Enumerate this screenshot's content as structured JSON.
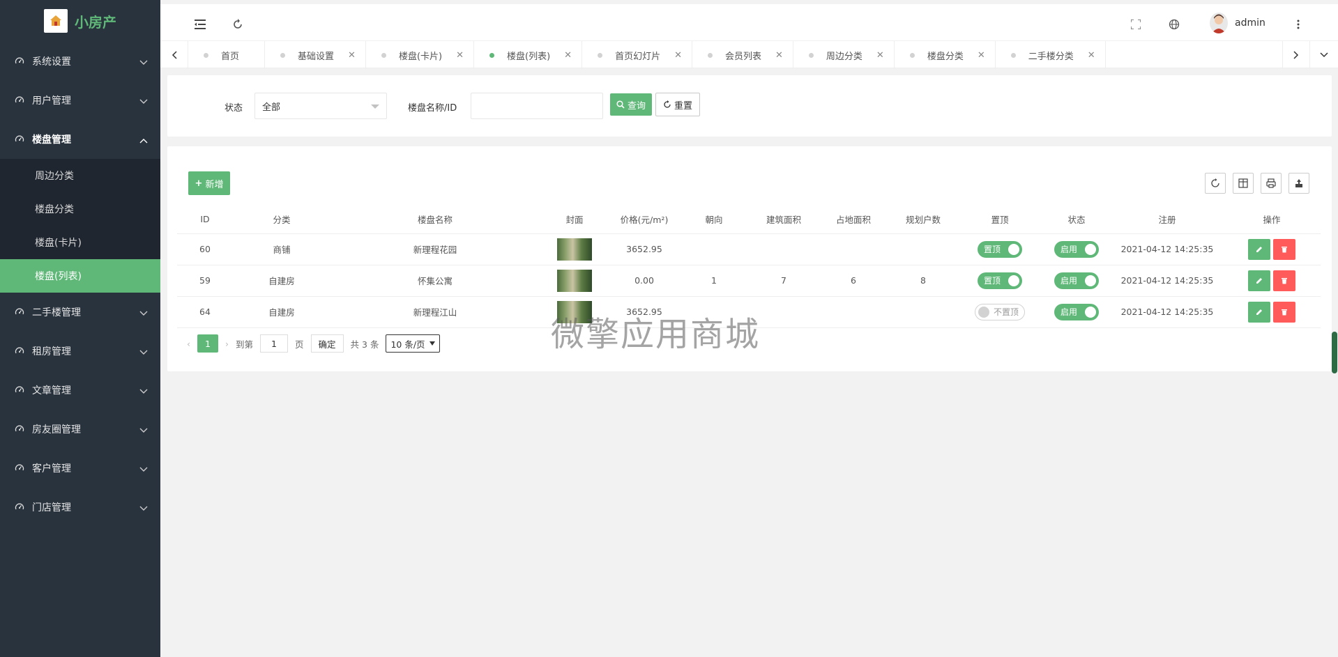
{
  "app": {
    "title": "小房产",
    "logo_icon": "house-logo-icon"
  },
  "colors": {
    "accent": "#5fb878",
    "sidebar_bg": "#28333e",
    "danger": "#ff5b5b"
  },
  "sidebar": {
    "items": [
      {
        "label": "系统设置",
        "open": false
      },
      {
        "label": "用户管理",
        "open": false
      },
      {
        "label": "楼盘管理",
        "open": true
      },
      {
        "label": "二手楼管理",
        "open": false
      },
      {
        "label": "租房管理",
        "open": false
      },
      {
        "label": "文章管理",
        "open": false
      },
      {
        "label": "房友圈管理",
        "open": false
      },
      {
        "label": "客户管理",
        "open": false
      },
      {
        "label": "门店管理",
        "open": false
      }
    ],
    "submenu": [
      {
        "label": "周边分类"
      },
      {
        "label": "楼盘分类"
      },
      {
        "label": "楼盘(卡片)"
      },
      {
        "label": "楼盘(列表)",
        "active": true
      }
    ]
  },
  "header": {
    "user": "admin"
  },
  "tabs": [
    {
      "label": "首页",
      "closable": false
    },
    {
      "label": "基础设置",
      "closable": true
    },
    {
      "label": "楼盘(卡片)",
      "closable": true
    },
    {
      "label": "楼盘(列表)",
      "closable": true,
      "active": true
    },
    {
      "label": "首页幻灯片",
      "closable": true
    },
    {
      "label": "会员列表",
      "closable": true
    },
    {
      "label": "周边分类",
      "closable": true
    },
    {
      "label": "楼盘分类",
      "closable": true
    },
    {
      "label": "二手楼分类",
      "closable": true
    }
  ],
  "search": {
    "status_label": "状态",
    "status_value": "全部",
    "name_label": "楼盘名称/ID",
    "name_value": "",
    "query_label": "查询",
    "reset_label": "重置"
  },
  "table": {
    "add_label": "新增",
    "columns": [
      "ID",
      "分类",
      "楼盘名称",
      "封面",
      "价格(元/m²)",
      "朝向",
      "建筑面积",
      "占地面积",
      "规划户数",
      "置顶",
      "状态",
      "注册",
      "操作"
    ],
    "rows": [
      {
        "id": "60",
        "category": "商铺",
        "name": "新理程花园",
        "price": "3652.95",
        "orientation": "",
        "build_area": "",
        "land_area": "",
        "households": "",
        "top": "置顶",
        "top_on": true,
        "status": "启用",
        "date": "2021-04-12 14:25:35"
      },
      {
        "id": "59",
        "category": "自建房",
        "name": "怀集公寓",
        "price": "0.00",
        "orientation": "1",
        "build_area": "7",
        "land_area": "6",
        "households": "8",
        "top": "置顶",
        "top_on": true,
        "status": "启用",
        "date": "2021-04-12 14:25:35"
      },
      {
        "id": "64",
        "category": "自建房",
        "name": "新理程江山",
        "price": "3652.95",
        "orientation": "",
        "build_area": "",
        "land_area": "",
        "households": "",
        "top": "不置顶",
        "top_on": false,
        "status": "启用",
        "date": "2021-04-12 14:25:35"
      }
    ]
  },
  "pager": {
    "current": "1",
    "goto_label": "到第",
    "goto_value": "1",
    "page_unit": "页",
    "confirm_label": "确定",
    "total": "共 3 条",
    "page_size": "10 条/页"
  },
  "watermark": "微擎应用商城"
}
